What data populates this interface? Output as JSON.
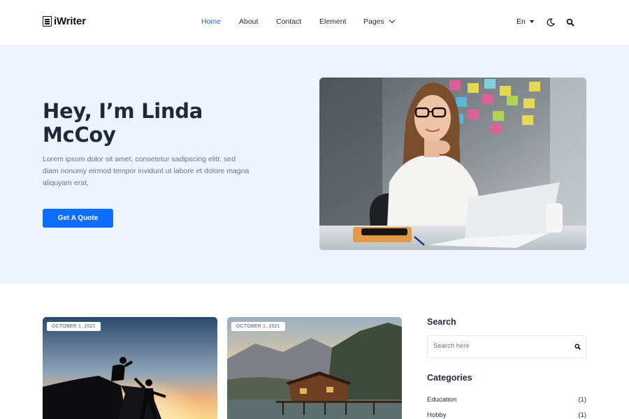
{
  "brand": {
    "name": "iWriter"
  },
  "nav": {
    "home": "Home",
    "about": "About",
    "contact": "Contact",
    "element": "Element",
    "pages": "Pages"
  },
  "header": {
    "lang": "En",
    "icons": [
      "moon-icon",
      "search-icon"
    ]
  },
  "hero": {
    "title": "Hey, I’m Linda McCoy",
    "description": "Lorem ipsum dolor sit amet, consetetur sadipscing elitr, sed diam nonumy eirmod tempor invidunt ut labore et dolore magna aliquyam erat,",
    "cta": "Get A Quote"
  },
  "posts": [
    {
      "date": "OCTOBER 1, 2021"
    },
    {
      "date": "OCTOBER 1, 2021"
    }
  ],
  "sidebar": {
    "search_title": "Search",
    "search_placeholder": "Search here",
    "categories_title": "Categories",
    "categories": [
      {
        "name": "Education",
        "count": "(1)"
      },
      {
        "name": "Hobby",
        "count": "(1)"
      }
    ]
  },
  "colors": {
    "accent": "#0d6efd",
    "hero_bg": "#eef4ff",
    "heading": "#1e2a3b"
  }
}
